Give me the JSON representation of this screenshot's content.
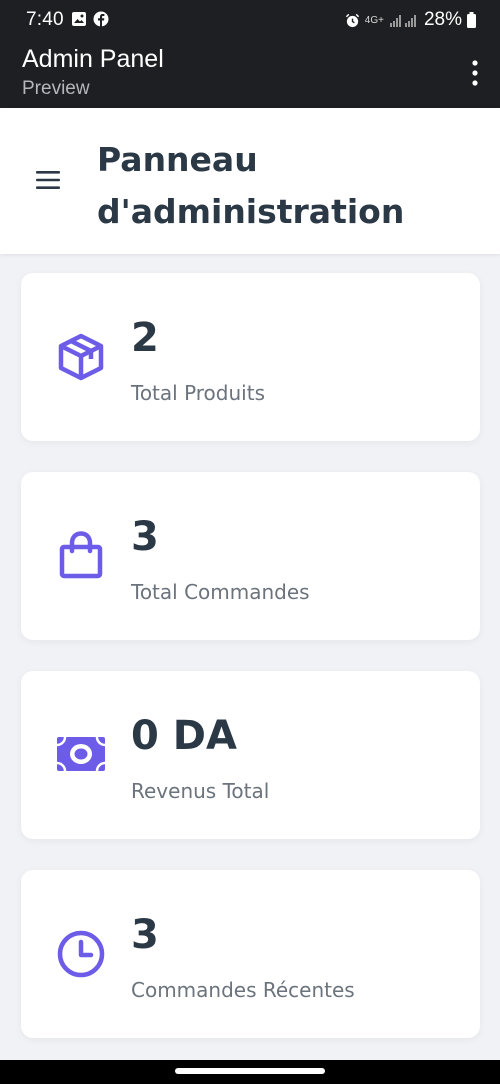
{
  "status_bar": {
    "time": "7:40",
    "battery": "28%",
    "network": "4G+",
    "left_icons": [
      "image-icon",
      "facebook-icon"
    ],
    "right_icons": [
      "alarm-icon",
      "signal-icon",
      "battery-icon"
    ]
  },
  "app_bar": {
    "title": "Admin Panel",
    "subtitle": "Preview",
    "menu_icon": "more-vert-icon"
  },
  "header": {
    "menu_icon": "hamburger-icon",
    "title": "Panneau d'administration"
  },
  "cards": [
    {
      "icon": "cube-icon",
      "value": "2",
      "label": "Total Produits"
    },
    {
      "icon": "shopping-bag-icon",
      "value": "3",
      "label": "Total Commandes"
    },
    {
      "icon": "money-icon",
      "value": "0 DA",
      "label": "Revenus Total"
    },
    {
      "icon": "clock-icon",
      "value": "3",
      "label": "Commandes Récentes"
    }
  ],
  "colors": {
    "accent": "#6c5ce7",
    "text_dark": "#2b3846",
    "text_muted": "#6b737c",
    "background": "#f1f2f5",
    "app_bar": "#1d1f22"
  }
}
